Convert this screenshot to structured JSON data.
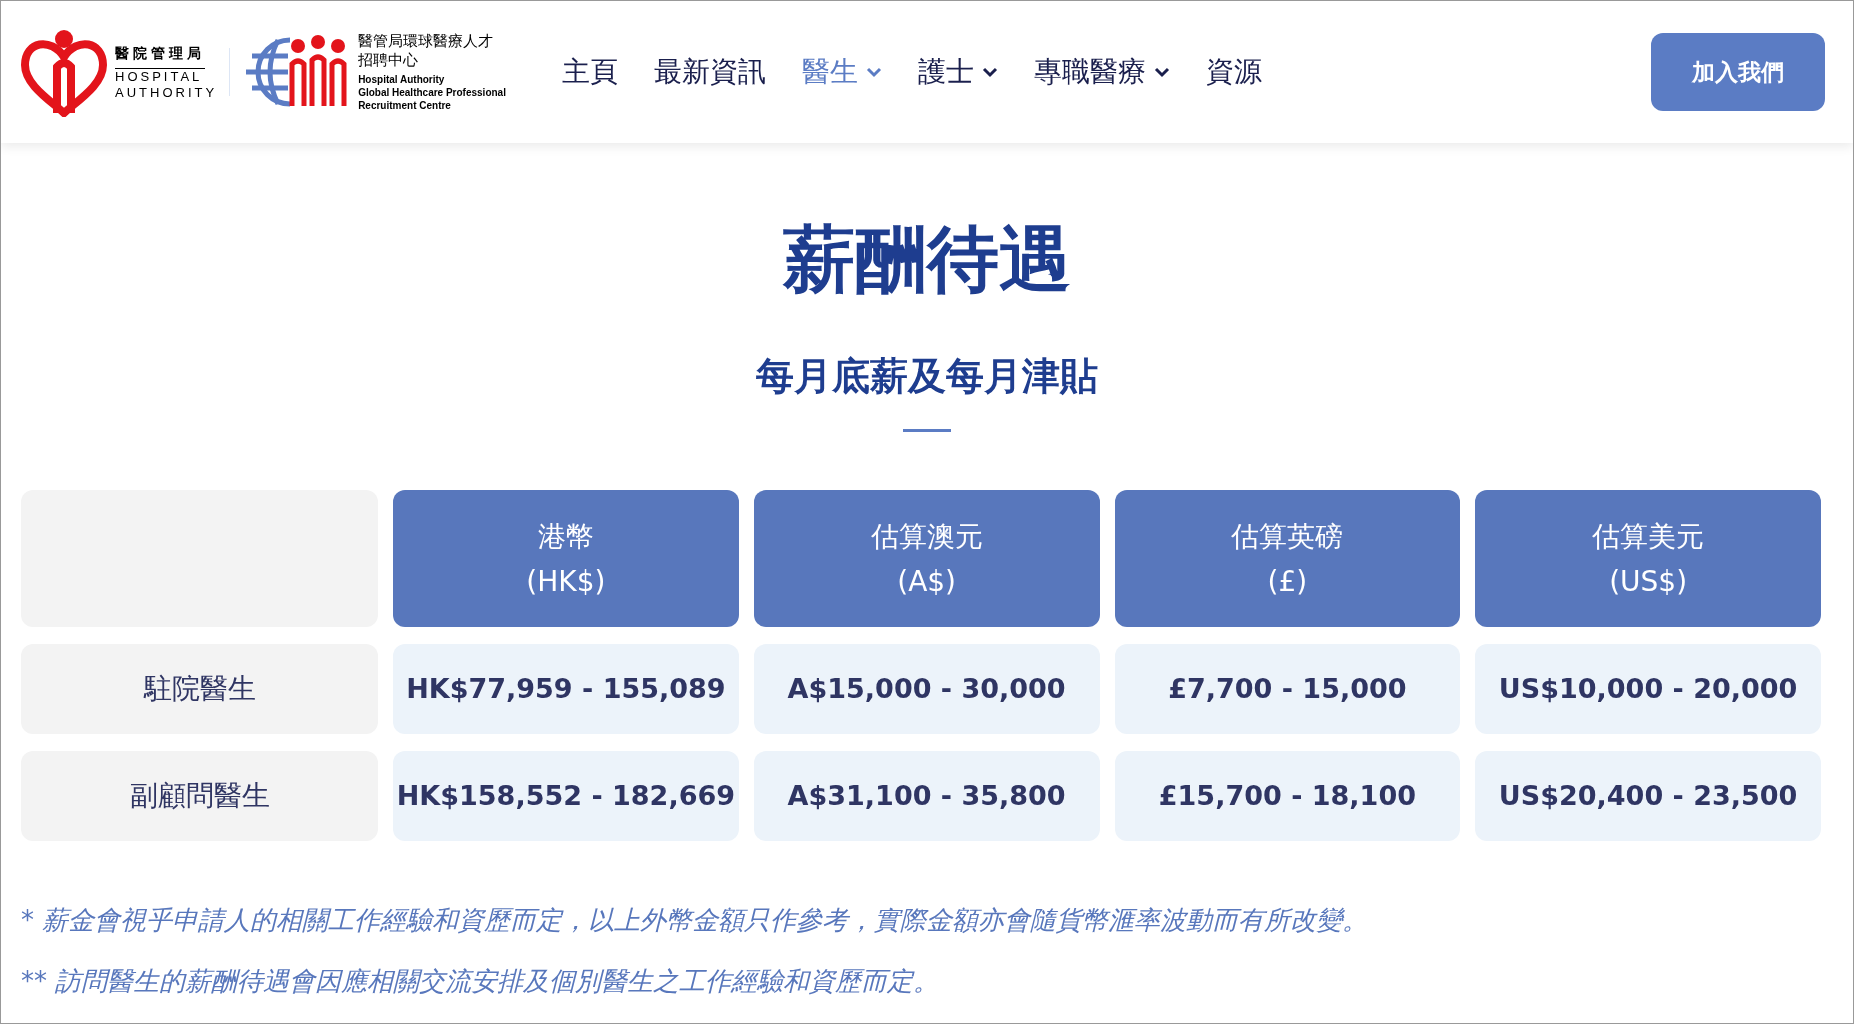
{
  "header": {
    "logo_ha": {
      "name_zh": "醫院管理局",
      "name_en_1": "HOSPITAL",
      "name_en_2": "AUTHORITY"
    },
    "logo_centre": {
      "name_zh_1": "醫管局環球醫療人才",
      "name_zh_2": "招聘中心",
      "name_en": [
        "Hospital Authority",
        "Global Healthcare Professional",
        "Recruitment Centre"
      ]
    },
    "nav": [
      {
        "label": "主頁",
        "selected": false,
        "dropdown": false
      },
      {
        "label": "最新資訊",
        "selected": false,
        "dropdown": false
      },
      {
        "label": "醫生",
        "selected": true,
        "dropdown": true
      },
      {
        "label": "護士",
        "selected": false,
        "dropdown": true
      },
      {
        "label": "專職醫療",
        "selected": false,
        "dropdown": true
      },
      {
        "label": "資源",
        "selected": false,
        "dropdown": false
      }
    ],
    "join_button": "加入我們"
  },
  "title": "薪酬待遇",
  "subtitle": "每月底薪及每月津貼",
  "table": {
    "columns": [
      {
        "name": "港幣",
        "unit": "(HK$)"
      },
      {
        "name": "估算澳元",
        "unit": "(A$)"
      },
      {
        "name": "估算英磅",
        "unit": "(£)"
      },
      {
        "name": "估算美元",
        "unit": "(US$)"
      }
    ],
    "rows": [
      {
        "label": "駐院醫生",
        "cells": [
          "HK$77,959 - 155,089",
          "A$15,000 - 30,000",
          "£7,700 - 15,000",
          "US$10,000 - 20,000"
        ]
      },
      {
        "label": "副顧問醫生",
        "cells": [
          "HK$158,552 - 182,669",
          "A$31,100 - 35,800",
          "£15,700 - 18,100",
          "US$20,400 - 23,500"
        ]
      }
    ]
  },
  "notes": [
    "* 薪金會視乎申請人的相關工作經驗和資歷而定，以上外幣金額只作參考，實際金額亦會隨貨幣滙率波動而有所改變。",
    "** 訪問醫生的薪酬待遇會因應相關交流安排及個別醫生之工作經驗和資歷而定。"
  ]
}
